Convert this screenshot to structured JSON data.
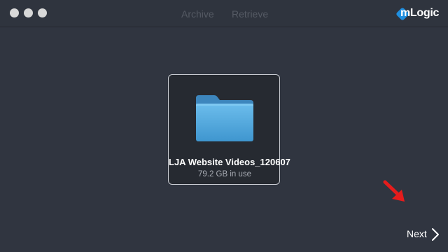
{
  "window": {
    "tabs": [
      {
        "label": "Archive"
      },
      {
        "label": "Retrieve"
      }
    ],
    "logo_text": "mLogic"
  },
  "main": {
    "volume": {
      "name": "LJA Website Videos_120607",
      "usage": "79.2 GB in use",
      "icon": "folder-icon"
    }
  },
  "footer": {
    "next_label": "Next",
    "next_icon": "chevron-right-icon"
  },
  "colors": {
    "background": "#303540",
    "accent_logo": "#1f8fe0",
    "folder": "#5aaee0",
    "annotation_arrow": "#e51c1c"
  }
}
